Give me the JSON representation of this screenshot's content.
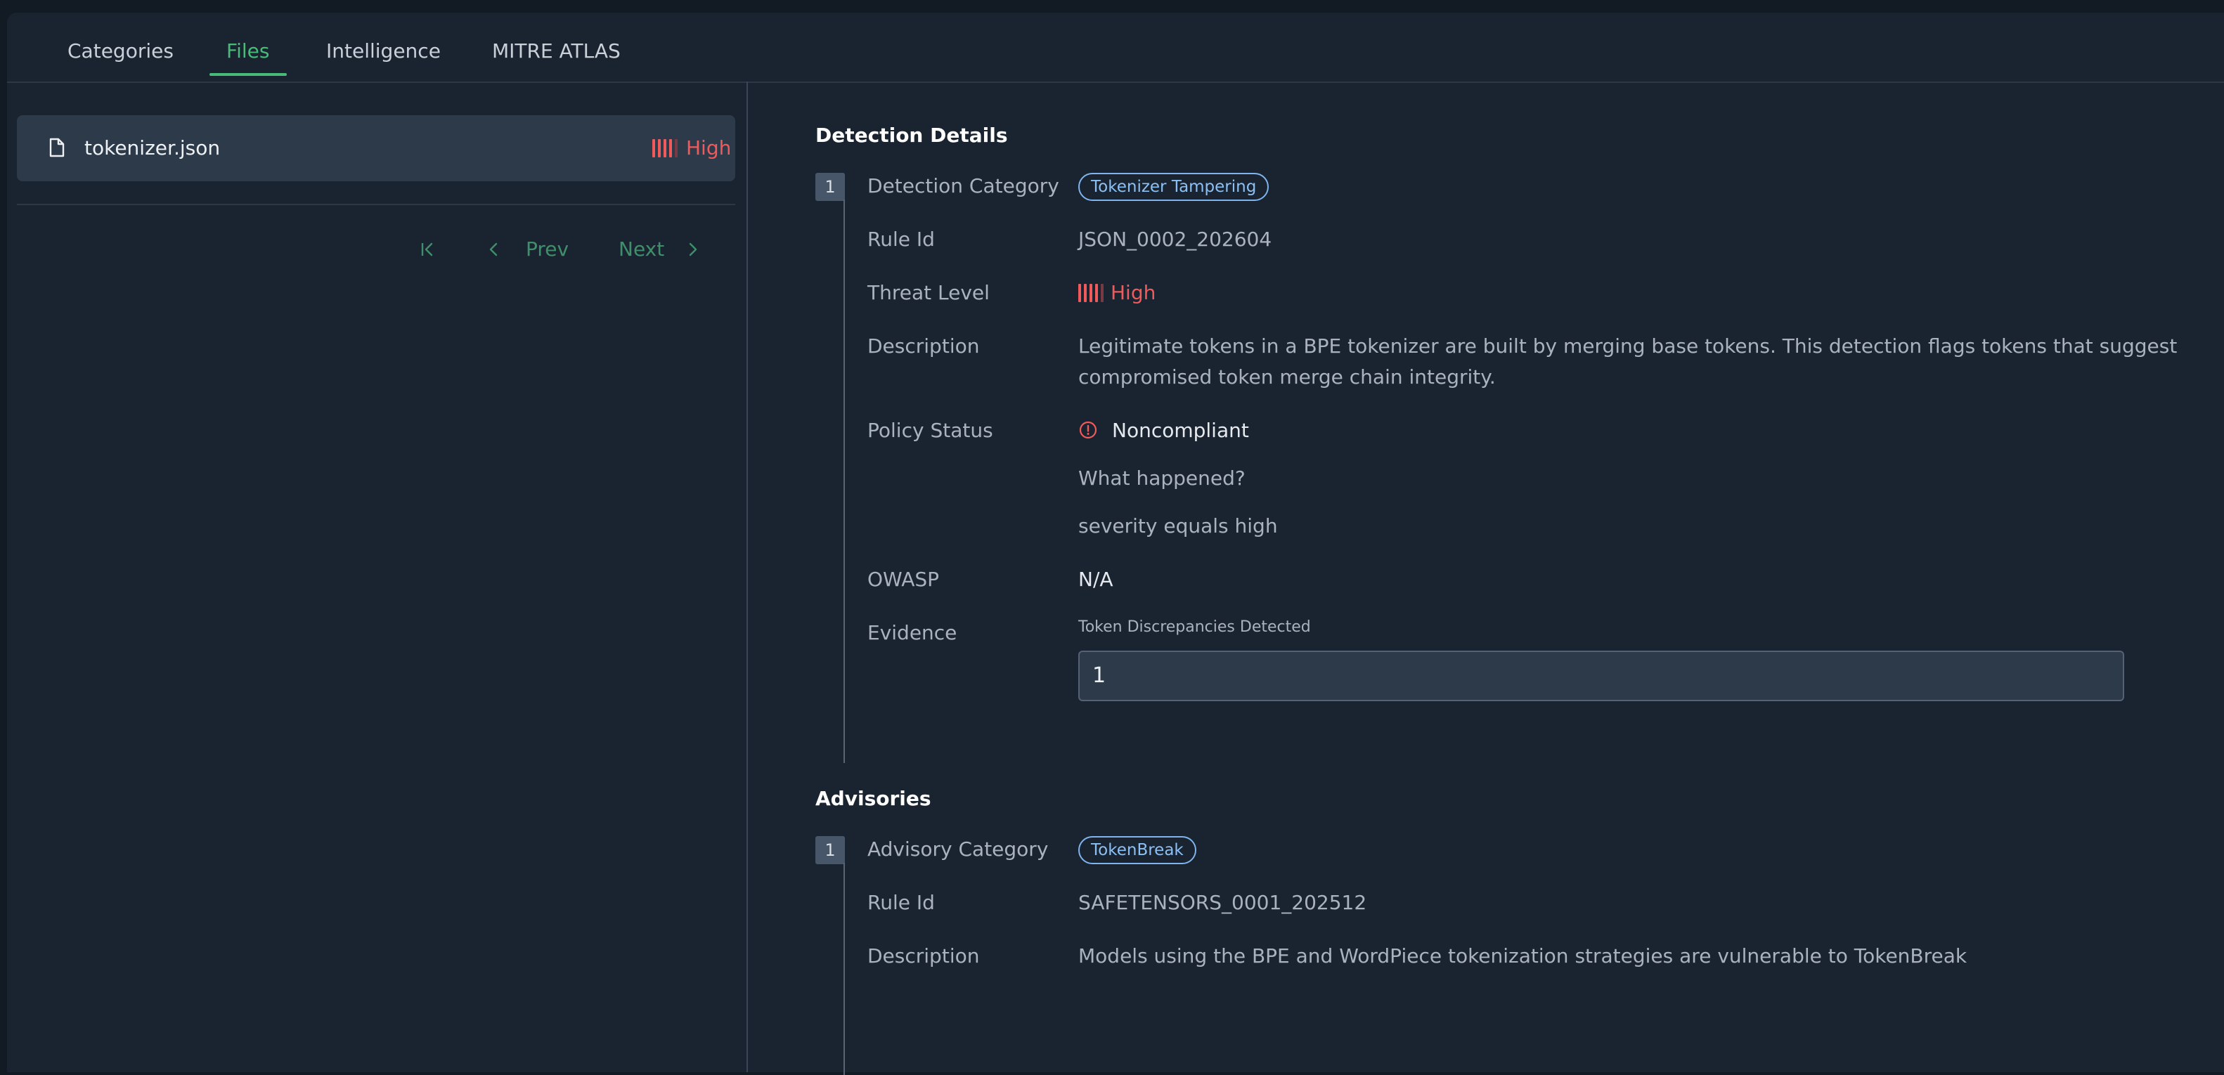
{
  "tabs": [
    {
      "label": "Categories",
      "active": false
    },
    {
      "label": "Files",
      "active": true
    },
    {
      "label": "Intelligence",
      "active": false
    },
    {
      "label": "MITRE ATLAS",
      "active": false
    }
  ],
  "files": [
    {
      "name": "tokenizer.json",
      "icon": "file-icon",
      "threat": "High"
    }
  ],
  "pagination": {
    "prev": "Prev",
    "next": "Next"
  },
  "detection_details": {
    "title": "Detection Details",
    "index": "1",
    "labels": {
      "category": "Detection Category",
      "rule_id": "Rule Id",
      "threat_level": "Threat Level",
      "description": "Description",
      "policy_status": "Policy Status",
      "owasp": "OWASP",
      "evidence": "Evidence"
    },
    "category": "Tokenizer Tampering",
    "rule_id": "JSON_0002_202604",
    "threat_level": "High",
    "description_line1": "Legitimate tokens in a BPE tokenizer are built by merging base tokens. This detection flags tokens that suggest",
    "description_line2": "compromised token merge chain integrity.",
    "policy_status": "Noncompliant",
    "what_happened": "What happened?",
    "reason": "severity equals high",
    "owasp": "N/A",
    "evidence_label": "Token Discrepancies Detected",
    "evidence_value": "1"
  },
  "advisories": {
    "title": "Advisories",
    "index": "1",
    "labels": {
      "category": "Advisory Category",
      "rule_id": "Rule Id",
      "description": "Description"
    },
    "category": "TokenBreak",
    "rule_id": "SAFETENSORS_0001_202512",
    "description": "Models using the BPE and WordPiece tokenization strategies are vulnerable to TokenBreak"
  },
  "colors": {
    "accent": "#48bb78",
    "threat_high": "#f05a5a",
    "pill": "#8cc0f4",
    "background": "#1a2431"
  }
}
